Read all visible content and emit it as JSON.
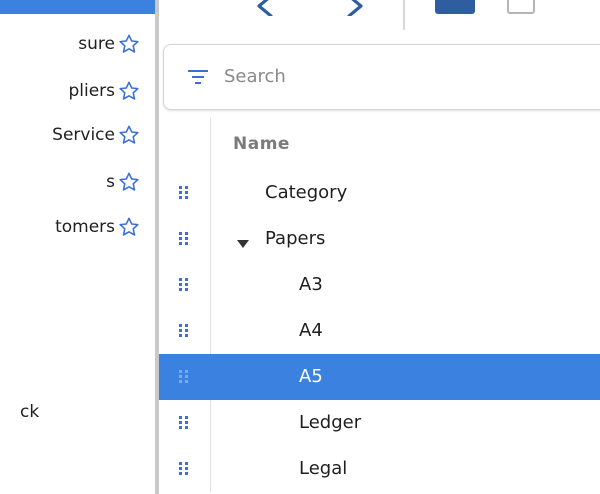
{
  "sidebar": {
    "items": [
      {
        "label": "sure",
        "icon": "star-outline-icon"
      },
      {
        "label": "pliers",
        "icon": "star-outline-icon"
      },
      {
        "label": "Service",
        "icon": "star-outline-icon"
      },
      {
        "label": "s",
        "icon": "star-outline-icon"
      },
      {
        "label": "tomers",
        "icon": "star-outline-icon"
      }
    ],
    "bottom_label": "ck"
  },
  "toolbar": {
    "icons": [
      "back-arrow-icon",
      "forward-arrow-icon",
      "list-view-icon",
      "grid-view-icon"
    ]
  },
  "search": {
    "placeholder": "Search",
    "value": "",
    "icon": "filter-icon"
  },
  "table": {
    "column_name": "Name",
    "rows": [
      {
        "name": "Category",
        "level": 0,
        "expandable": false,
        "selected": false
      },
      {
        "name": "Papers",
        "level": 0,
        "expandable": true,
        "expanded": true,
        "selected": false
      },
      {
        "name": "A3",
        "level": 1,
        "expandable": false,
        "selected": false
      },
      {
        "name": "A4",
        "level": 1,
        "expandable": false,
        "selected": false
      },
      {
        "name": "A5",
        "level": 1,
        "expandable": false,
        "selected": true
      },
      {
        "name": "Ledger",
        "level": 1,
        "expandable": false,
        "selected": false
      },
      {
        "name": "Legal",
        "level": 1,
        "expandable": false,
        "selected": false
      }
    ]
  },
  "colors": {
    "accent": "#3b82e0",
    "star": "#3b6fd8",
    "drag_handle": "#3b6fd8"
  }
}
